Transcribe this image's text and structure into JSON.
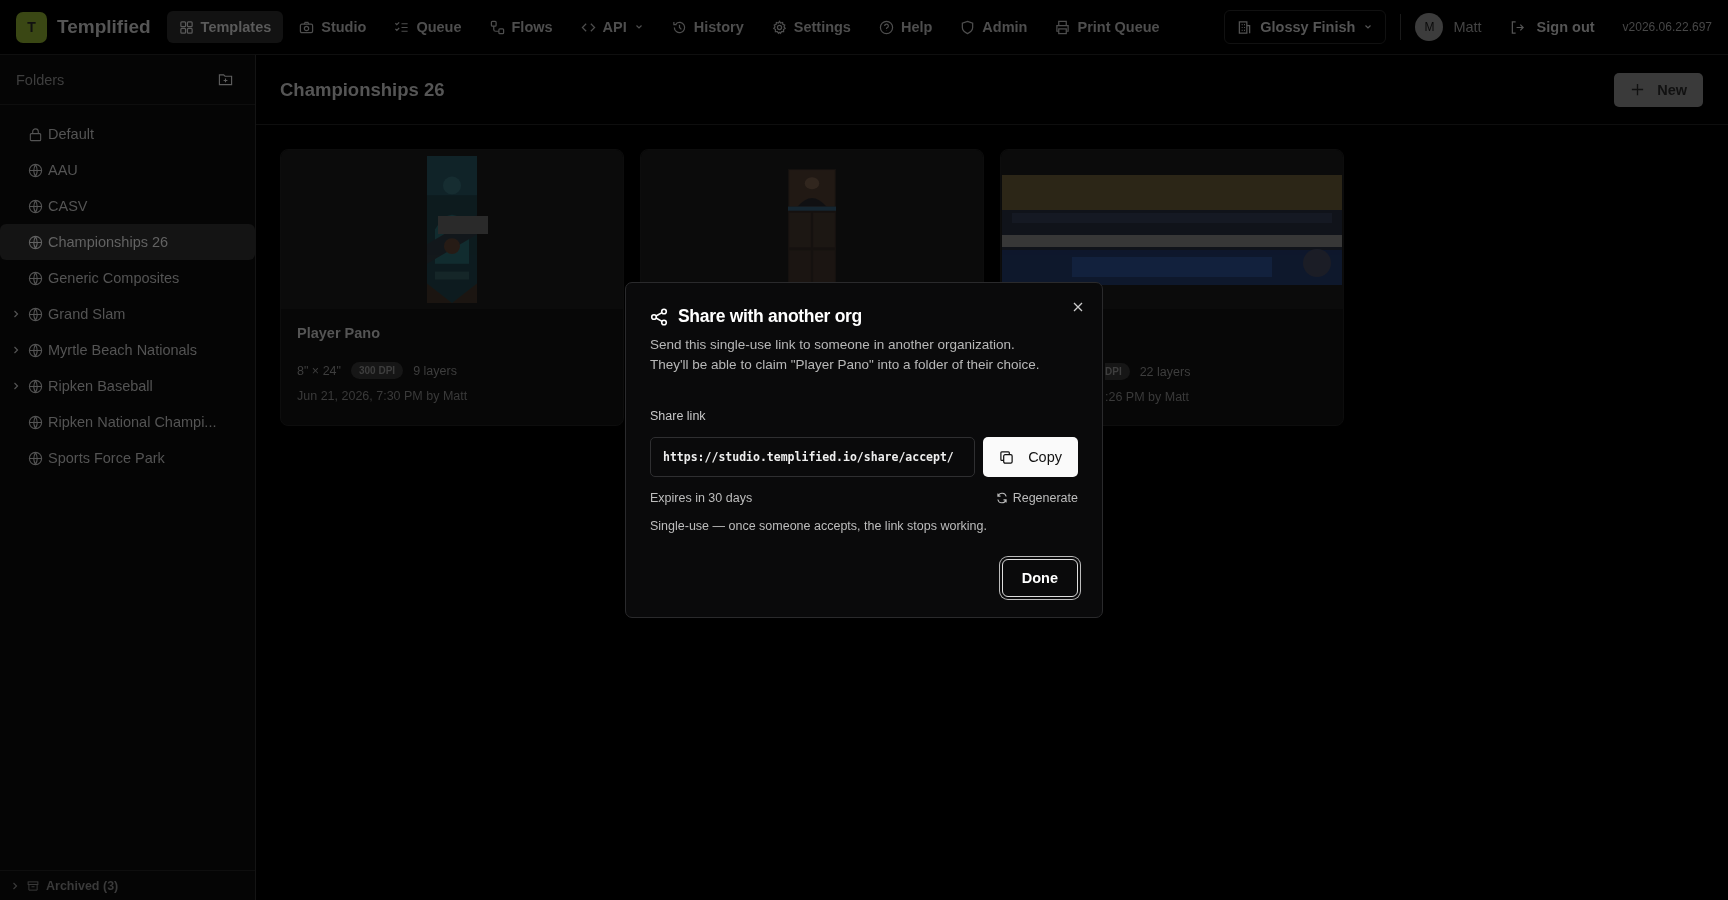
{
  "app": {
    "logo_letter": "T",
    "name": "Templified"
  },
  "nav": [
    {
      "label": "Templates",
      "selected": true,
      "has_menu": false
    },
    {
      "label": "Studio",
      "selected": false,
      "has_menu": false
    },
    {
      "label": "Queue",
      "selected": false,
      "has_menu": false
    },
    {
      "label": "Flows",
      "selected": false,
      "has_menu": false
    },
    {
      "label": "API",
      "selected": false,
      "has_menu": true
    },
    {
      "label": "History",
      "selected": false,
      "has_menu": false
    },
    {
      "label": "Settings",
      "selected": false,
      "has_menu": false
    },
    {
      "label": "Help",
      "selected": false,
      "has_menu": false
    },
    {
      "label": "Admin",
      "selected": false,
      "has_menu": false
    },
    {
      "label": "Print Queue",
      "selected": false,
      "has_menu": false
    }
  ],
  "org_switcher": {
    "label": "Glossy Finish"
  },
  "user": {
    "initial": "M",
    "name": "Matt"
  },
  "sign_out": "Sign out",
  "version": "v2026.06.22.697",
  "sidebar": {
    "title": "Folders",
    "folders": [
      {
        "name": "Default",
        "kind": "private",
        "has_children": false,
        "selected": false
      },
      {
        "name": "AAU",
        "kind": "shared",
        "has_children": false,
        "selected": false
      },
      {
        "name": "CASV",
        "kind": "shared",
        "has_children": false,
        "selected": false
      },
      {
        "name": "Championships 26",
        "kind": "shared",
        "has_children": false,
        "selected": true
      },
      {
        "name": "Generic Composites",
        "kind": "shared",
        "has_children": false,
        "selected": false
      },
      {
        "name": "Grand Slam",
        "kind": "shared",
        "has_children": true,
        "selected": false
      },
      {
        "name": "Myrtle Beach Nationals",
        "kind": "shared",
        "has_children": true,
        "selected": false
      },
      {
        "name": "Ripken Baseball",
        "kind": "shared",
        "has_children": true,
        "selected": false
      },
      {
        "name": "Ripken National Champi...",
        "kind": "shared",
        "has_children": false,
        "selected": false
      },
      {
        "name": "Sports Force Park",
        "kind": "shared",
        "has_children": false,
        "selected": false
      }
    ],
    "archived": "Archived (3)"
  },
  "page": {
    "title": "Championships 26",
    "new_button": "New"
  },
  "cards": [
    {
      "kind": "full",
      "title": "Player Pano",
      "size": "8\" × 24\"",
      "dpi": "300 DPI",
      "layers": "9 layers",
      "date": "Jun 21, 2026, 7:30 PM by Matt"
    },
    {
      "kind": "covered"
    },
    {
      "kind": "partial",
      "dpi": "DPI",
      "layers": "22 layers",
      "date": ":26 PM by Matt"
    }
  ],
  "dialog": {
    "title": "Share with another org",
    "description": [
      "Send this single-use link to someone in another organization.",
      "They'll be able to claim \"Player Pano\" into a folder of their choice."
    ],
    "link_label": "Share link",
    "link_value": "https://studio.templified.io/share/accept/",
    "copy_button": "Copy",
    "expiry": "Expires in 30 days",
    "regenerate": "Regenerate",
    "note": "Single-use — once someone accepts, the link stops working.",
    "done_button": "Done"
  }
}
